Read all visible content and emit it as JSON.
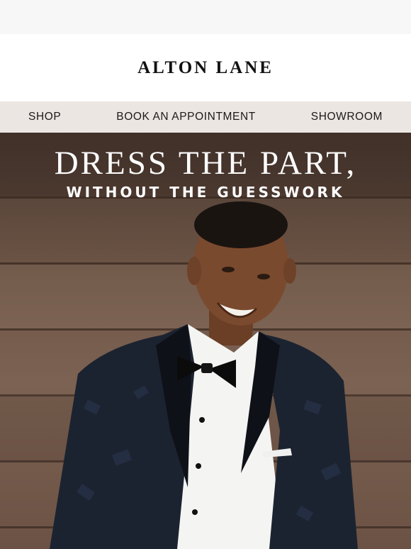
{
  "brand": {
    "name": "ALTON LANE"
  },
  "nav": {
    "items": [
      {
        "label": "SHOP"
      },
      {
        "label": "BOOK AN APPOINTMENT"
      },
      {
        "label": "SHOWROOM"
      }
    ]
  },
  "hero": {
    "heading": "DRESS THE PART,",
    "subheading": "WITHOUT THE GUESSWORK"
  },
  "colors": {
    "nav_background": "#ece6e2",
    "wood": "#6e5647",
    "tuxedo": "#1c2330",
    "shirt": "#f4f4f2"
  }
}
